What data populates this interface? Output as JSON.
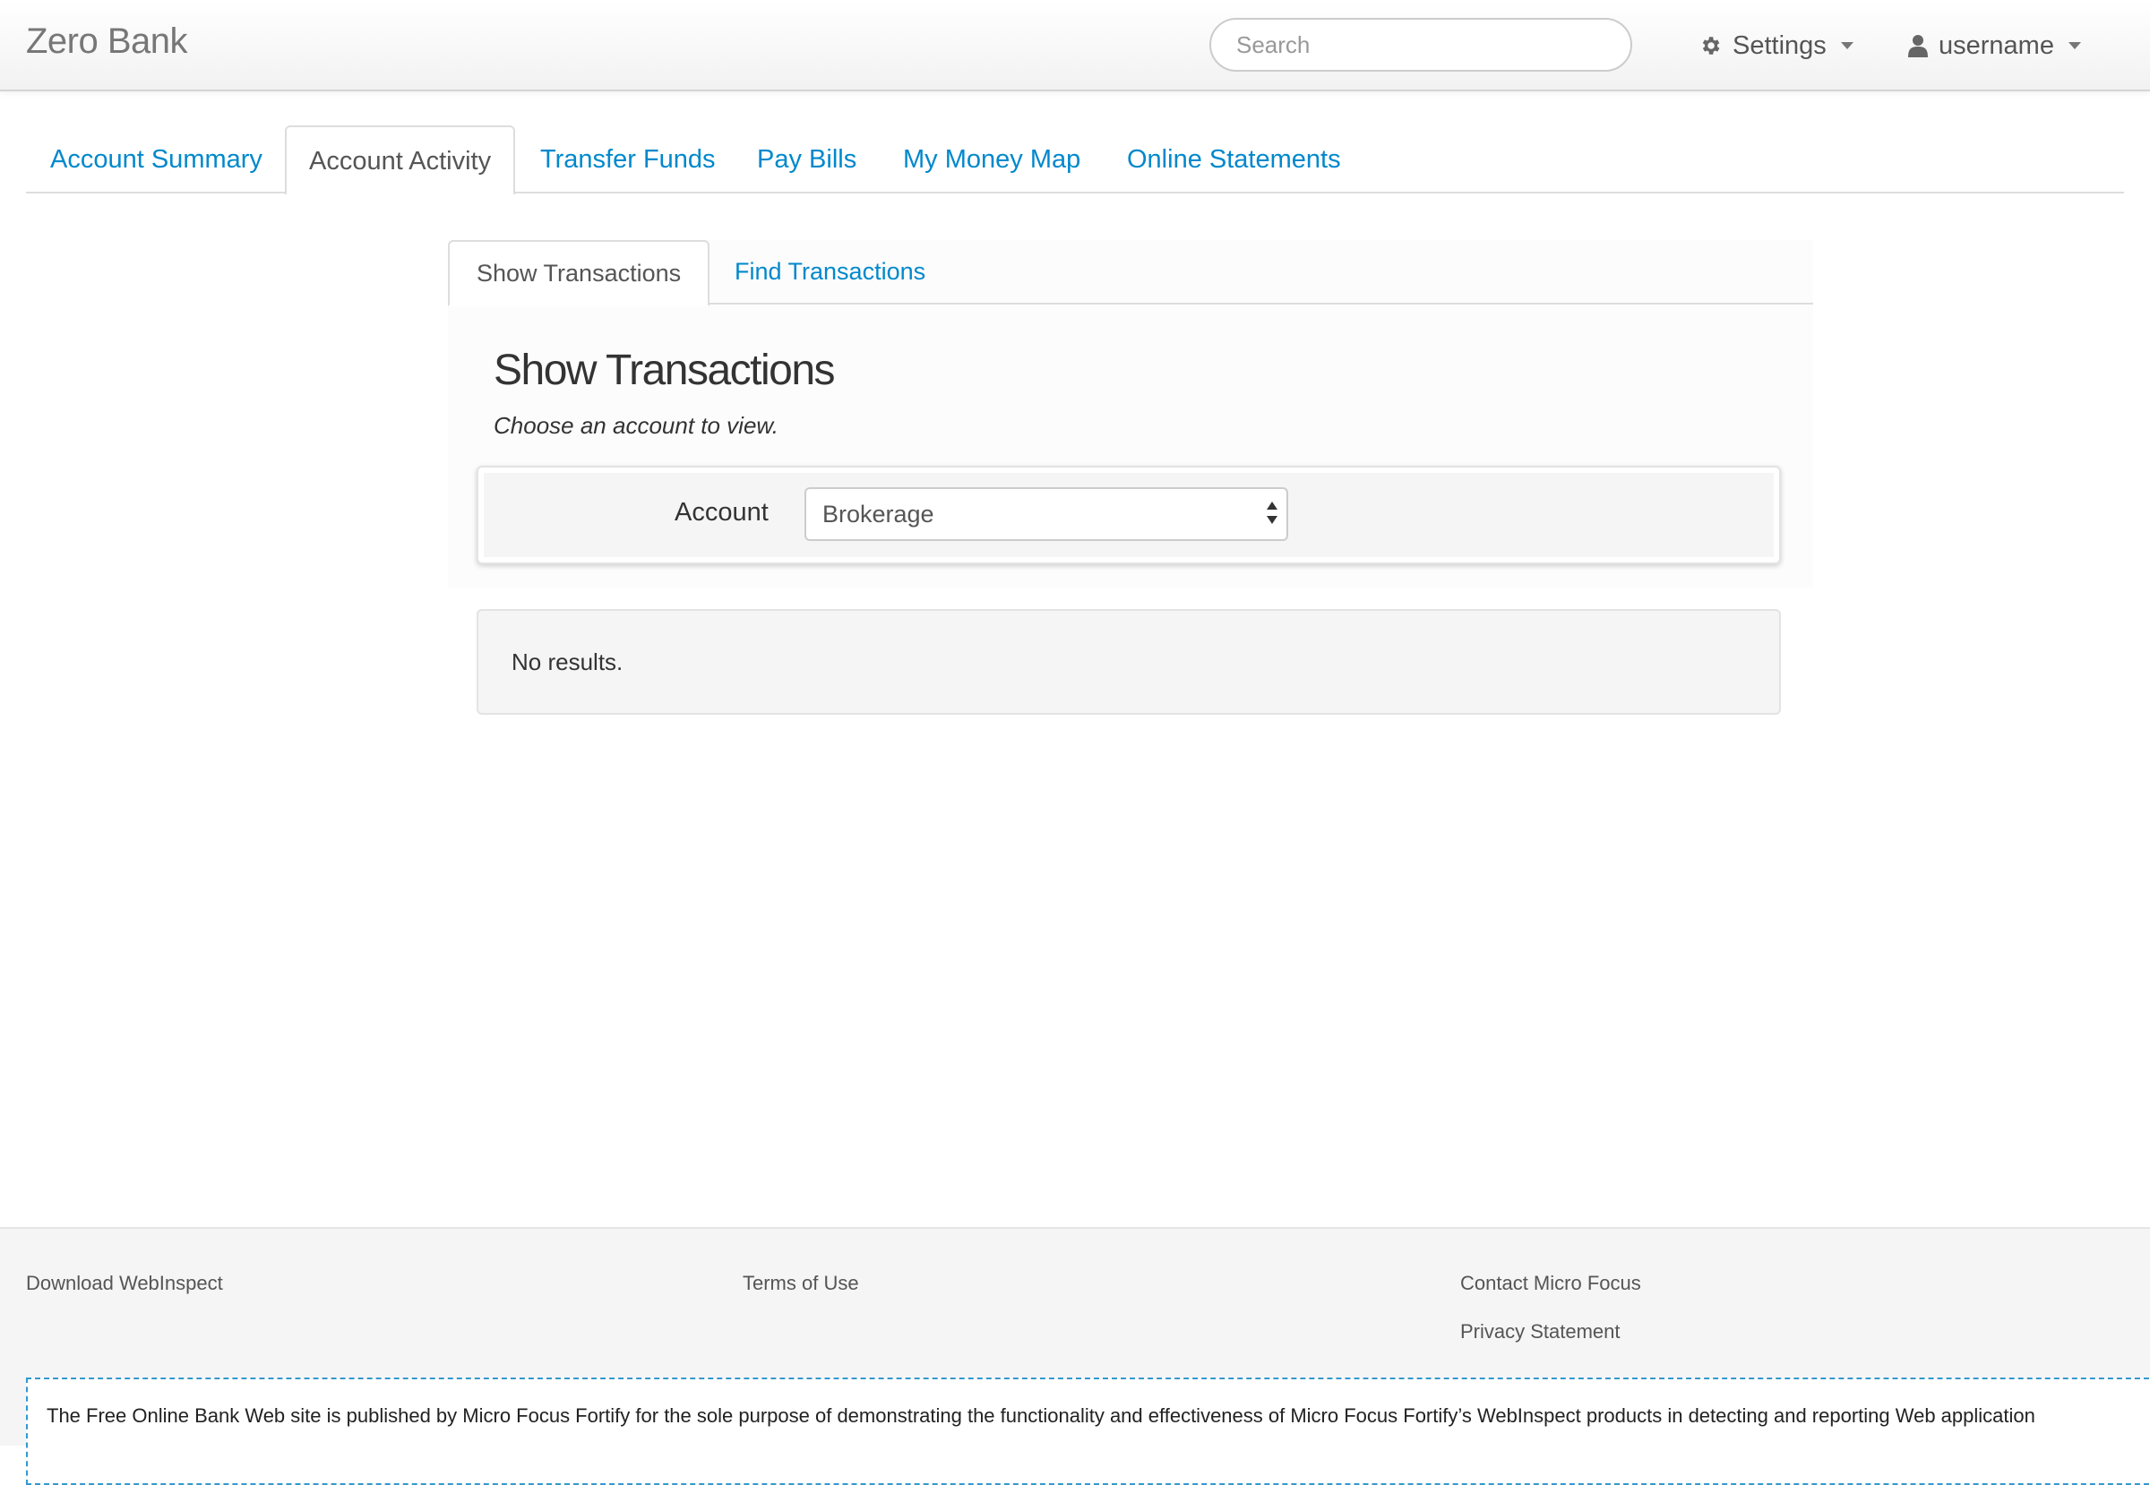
{
  "navbar": {
    "brand": "Zero Bank",
    "search_placeholder": "Search",
    "settings_label": "Settings",
    "user_label": "username"
  },
  "main_tabs": [
    {
      "label": "Account Summary",
      "active": false
    },
    {
      "label": "Account Activity",
      "active": true
    },
    {
      "label": "Transfer Funds",
      "active": false
    },
    {
      "label": "Pay Bills",
      "active": false
    },
    {
      "label": "My Money Map",
      "active": false
    },
    {
      "label": "Online Statements",
      "active": false
    }
  ],
  "sub_tabs": [
    {
      "label": "Show Transactions",
      "active": true
    },
    {
      "label": "Find Transactions",
      "active": false
    }
  ],
  "content": {
    "title": "Show Transactions",
    "subtitle": "Choose an account to view.",
    "account_label": "Account",
    "account_selected": "Brokerage",
    "results_text": "No results."
  },
  "footer": {
    "download": "Download WebInspect",
    "terms": "Terms of Use",
    "contact": "Contact Micro Focus",
    "privacy": "Privacy Statement",
    "disclaimer": "The Free Online Bank Web site is published by Micro Focus Fortify for the sole purpose of demonstrating the functionality and effectiveness of Micro Focus Fortify’s WebInspect products in detecting and reporting Web application"
  },
  "colors": {
    "link": "#0088cc",
    "disclaimer_border": "#3399cc"
  }
}
